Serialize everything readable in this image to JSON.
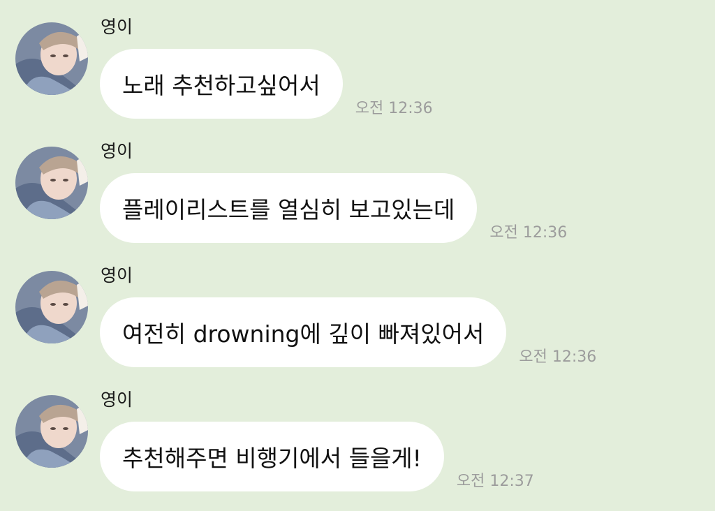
{
  "messages": [
    {
      "sender": "영이",
      "text": "노래 추천하고싶어서",
      "time": "오전 12:36"
    },
    {
      "sender": "영이",
      "text": "플레이리스트를 열심히 보고있는데",
      "time": "오전 12:36"
    },
    {
      "sender": "영이",
      "text": "여전히 drowning에 깊이 빠져있어서",
      "time": "오전 12:36"
    },
    {
      "sender": "영이",
      "text": "추천해주면 비행기에서 들을게!",
      "time": "오전 12:37"
    }
  ]
}
